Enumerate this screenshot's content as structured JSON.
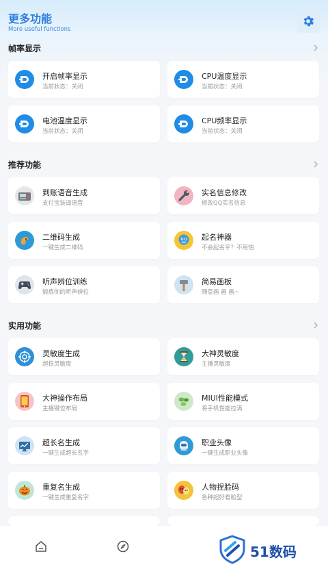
{
  "header": {
    "title": "更多功能",
    "subtitle": "More useful functions",
    "settings_icon": "gear-icon"
  },
  "sections": {
    "frame": {
      "title": "帧率显示"
    },
    "recommend": {
      "title": "推荐功能"
    },
    "practical": {
      "title": "实用功能"
    }
  },
  "cards": {
    "frame_rate": {
      "title": "开启帧率显示",
      "subtitle": "当前状态：关闭",
      "icon": "dash-icon"
    },
    "cpu_temp": {
      "title": "CPU温度显示",
      "subtitle": "当前状态：关闭",
      "icon": "dash-icon"
    },
    "battery_temp": {
      "title": "电池温度显示",
      "subtitle": "当前状态：关闭",
      "icon": "dash-icon"
    },
    "cpu_freq": {
      "title": "CPU频率显示",
      "subtitle": "当前状态：关闭",
      "icon": "dash-icon"
    },
    "voice": {
      "title": "到账语音生成",
      "subtitle": "支付宝装逼语音",
      "icon": "radio-icon"
    },
    "realname": {
      "title": "实名信息修改",
      "subtitle": "修改QQ实名信息",
      "icon": "wrench-icon"
    },
    "qrcode": {
      "title": "二维码生成",
      "subtitle": "一键生成二维码",
      "icon": "qrcode-icon"
    },
    "naming": {
      "title": "起名神器",
      "subtitle": "不会起名字？不用怕",
      "icon": "mascot-icon"
    },
    "sound": {
      "title": "听声辨位训练",
      "subtitle": "锻炼你的听声辨位",
      "icon": "gamepad-icon"
    },
    "drawing": {
      "title": "简易画板",
      "subtitle": "随意画 画 画~",
      "icon": "hammer-icon"
    },
    "sensitivity": {
      "title": "灵敏度生成",
      "subtitle": "超稳灵敏度",
      "icon": "target-icon"
    },
    "master_sens": {
      "title": "大神灵敏度",
      "subtitle": "主播灵敏度",
      "icon": "hourglass-icon"
    },
    "layout": {
      "title": "大神操作布局",
      "subtitle": "主播键位布局",
      "icon": "tablet-icon"
    },
    "miui": {
      "title": "MIUI性能模式",
      "subtitle": "将手机性能拉满",
      "icon": "leaf-icon"
    },
    "longname": {
      "title": "超长名生成",
      "subtitle": "一键生成超长名字",
      "icon": "monitor-icon"
    },
    "avatar": {
      "title": "职业头像",
      "subtitle": "一键生成职业头像",
      "icon": "robot-icon"
    },
    "dupname": {
      "title": "重复名生成",
      "subtitle": "一键生成重复名字",
      "icon": "pumpkin-icon"
    },
    "face": {
      "title": "人物捏脸码",
      "subtitle": "各种超好看脸型",
      "icon": "masks-icon"
    }
  },
  "colors": {
    "accent": "#2f7de1",
    "icon_blue": "#1f8ce6"
  },
  "watermark": {
    "text": "51数码"
  }
}
